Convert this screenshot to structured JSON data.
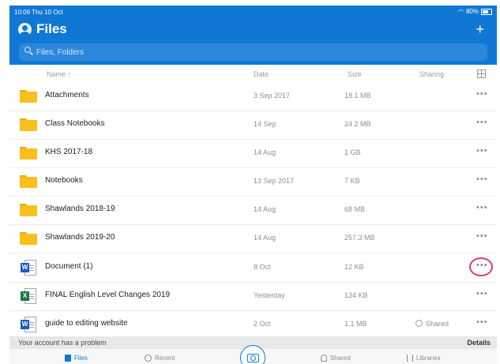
{
  "status_bar": {
    "time": "10:06  Thu 10 Oct",
    "battery": "80%"
  },
  "header": {
    "title": "Files",
    "add_label": "+"
  },
  "search": {
    "placeholder": "Files, Folders"
  },
  "columns": {
    "name": "Name  ↑",
    "date": "Date",
    "size": "Size",
    "sharing": "Sharing"
  },
  "files": [
    {
      "name": "Attachments",
      "date": "3 Sep 2017",
      "size": "18.1 MB",
      "sharing": "",
      "type": "folder",
      "more": "•••"
    },
    {
      "name": "Class Notebooks",
      "date": "14 Sep",
      "size": "24.2 MB",
      "sharing": "",
      "type": "folder",
      "more": "•••"
    },
    {
      "name": "KHS 2017-18",
      "date": "14 Aug",
      "size": "1 GB",
      "sharing": "",
      "type": "folder",
      "more": "•••"
    },
    {
      "name": "Notebooks",
      "date": "13 Sep 2017",
      "size": "7 KB",
      "sharing": "",
      "type": "folder",
      "more": "•••"
    },
    {
      "name": "Shawlands 2018-19",
      "date": "14 Aug",
      "size": "68 MB",
      "sharing": "",
      "type": "folder",
      "more": "•••"
    },
    {
      "name": "Shawlands 2019-20",
      "date": "14 Aug",
      "size": "257.3 MB",
      "sharing": "",
      "type": "folder",
      "more": "•••"
    },
    {
      "name": "Document (1)",
      "date": "8 Oct",
      "size": "12 KB",
      "sharing": "",
      "type": "word",
      "badge": "W",
      "more": "•••"
    },
    {
      "name": "FINAL English Level Changes 2019",
      "date": "Yesterday",
      "size": "134 KB",
      "sharing": "",
      "type": "excel",
      "badge": "X",
      "more": "•••"
    },
    {
      "name": "guide to editing website",
      "date": "2 Oct",
      "size": "1.1 MB",
      "sharing": "Shared",
      "type": "word",
      "badge": "W",
      "more": "•••"
    }
  ],
  "banner": {
    "message": "Your account has a problem",
    "action": "Details"
  },
  "tabs": [
    {
      "label": "Files",
      "icon": "file-icon"
    },
    {
      "label": "Recent",
      "icon": "clock-icon"
    },
    {
      "label": "Shared",
      "icon": "people-icon"
    },
    {
      "label": "Libraries",
      "icon": "library-icon"
    }
  ],
  "colors": {
    "brand": "#0f78d4",
    "folder": "#f8bf1d",
    "annotation": "#e13a61"
  }
}
